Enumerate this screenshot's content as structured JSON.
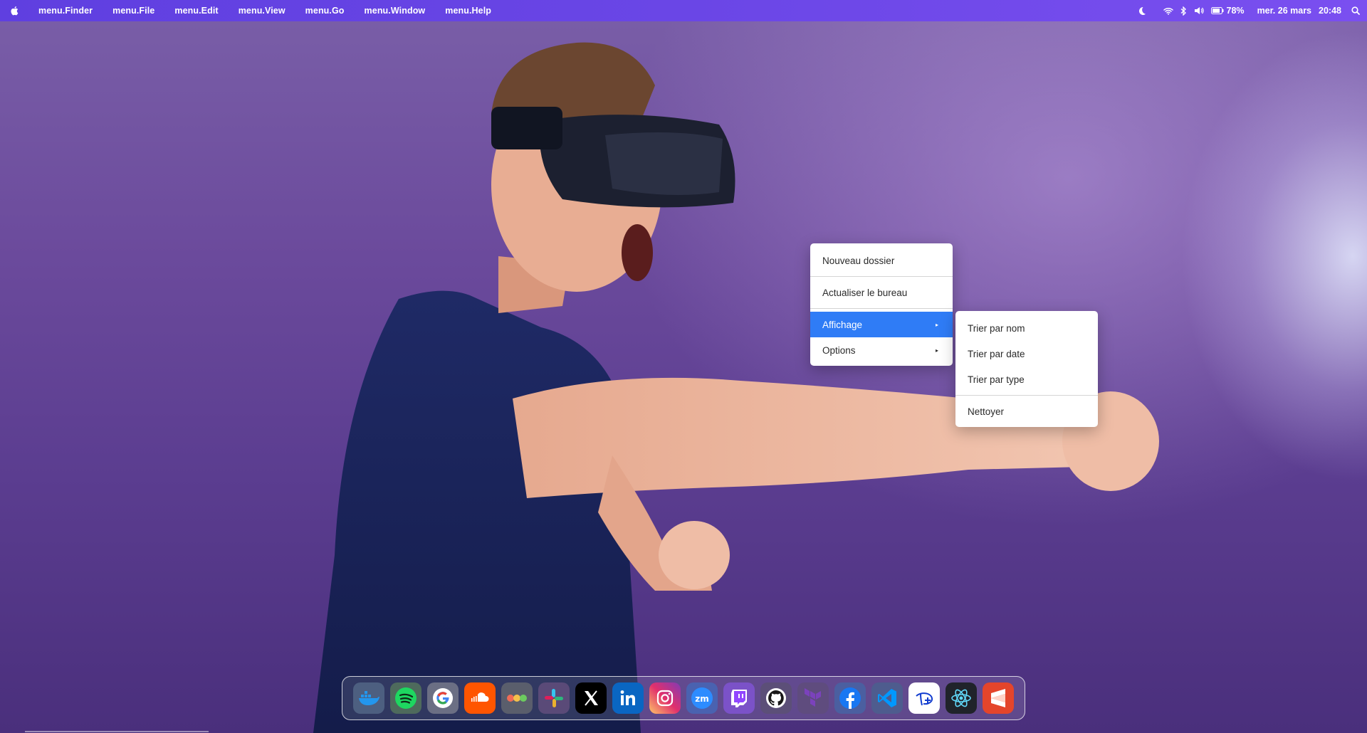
{
  "menubar": {
    "apple_icon": "apple-icon",
    "items": [
      "menu.Finder",
      "menu.File",
      "menu.Edit",
      "menu.View",
      "menu.Go",
      "menu.Window",
      "menu.Help"
    ],
    "status": {
      "icons": [
        "moon-icon",
        "wifi-icon",
        "bluetooth-icon",
        "volume-icon",
        "battery-icon",
        "search-icon"
      ],
      "battery": "78%",
      "date": "mer. 26 mars",
      "time": "20:48"
    }
  },
  "context_menu": {
    "items": [
      {
        "label": "Nouveau dossier"
      },
      {
        "label": "Actualiser le bureau"
      },
      {
        "label": "Affichage",
        "submenu": true,
        "active": true
      },
      {
        "label": "Options",
        "submenu": true
      }
    ]
  },
  "submenu": {
    "items": [
      "Trier par nom",
      "Trier par date",
      "Trier par type",
      "Nettoyer"
    ]
  },
  "dock": {
    "apps": [
      "docker-icon",
      "spotify-icon",
      "google-icon",
      "soundcloud-icon",
      "teams-dots-icon",
      "slack-icon",
      "x-icon",
      "linkedin-icon",
      "instagram-icon",
      "zoom-icon",
      "twitch-icon",
      "github-icon",
      "terraform-icon",
      "facebook-icon",
      "vscode-icon",
      "disney-plus-icon",
      "react-icon",
      "sublime-icon"
    ]
  },
  "colors": {
    "menubar": "#6a46e6",
    "menu_highlight": "#2f7cf6",
    "wallpaper": "#6b4a9c"
  }
}
